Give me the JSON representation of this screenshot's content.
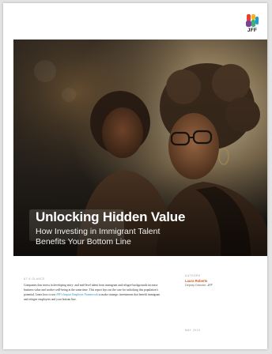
{
  "logo": {
    "text": "JFF",
    "colors": [
      "#e8402a",
      "#f2b61c",
      "#1e9bd7",
      "#7a3f98"
    ]
  },
  "cover": {
    "title": "Unlocking Hidden Value",
    "subtitle_line1": "How Investing in Immigrant Talent",
    "subtitle_line2": "Benefits Your Bottom Line"
  },
  "glance": {
    "label": "At a glance",
    "text_before_link": "Companies that invest in developing entry- and mid-level talent from immigrant and refugee backgrounds increase business value and worker well-being at the same time. This report lays out the case for unlocking this population’s potential. Learn how to use ",
    "link_text": "JFF’s Impact Employer Framework",
    "text_after_link": " to make strategic investments that benefit immigrant and refugee employees and your bottom line."
  },
  "authors": {
    "label": "Authors",
    "name": "Laura Roberts",
    "role": "Deputy Director,",
    "org": "JFF"
  },
  "date": "May 2023"
}
